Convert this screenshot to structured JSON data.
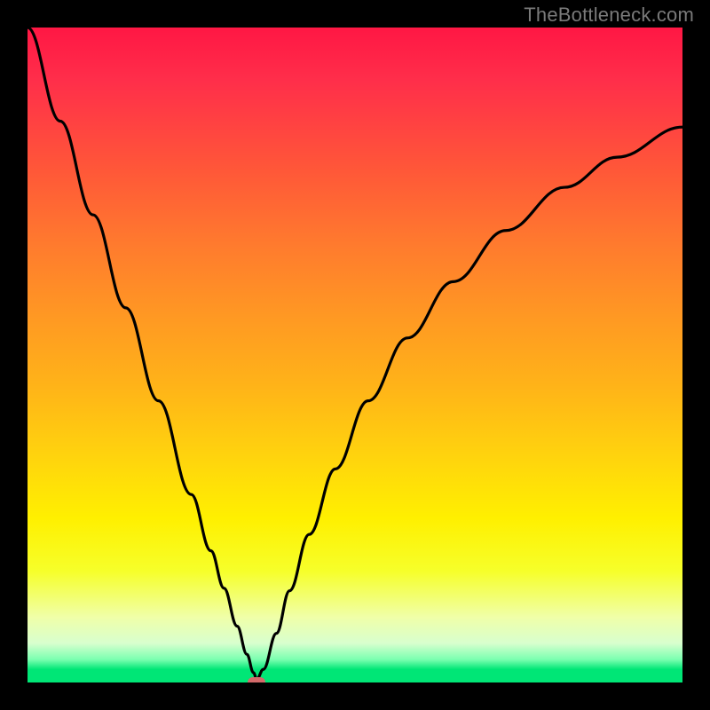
{
  "watermark": {
    "text": "TheBottleneck.com"
  },
  "chart_data": {
    "type": "line",
    "title": "",
    "xlabel": "",
    "ylabel": "",
    "xlim": [
      0,
      1
    ],
    "ylim": [
      0,
      1
    ],
    "grid": false,
    "series": [
      {
        "name": "bottleneck-curve",
        "x": [
          0.0,
          0.05,
          0.1,
          0.15,
          0.2,
          0.25,
          0.28,
          0.3,
          0.32,
          0.335,
          0.345,
          0.35,
          0.36,
          0.38,
          0.4,
          0.43,
          0.47,
          0.52,
          0.58,
          0.65,
          0.73,
          0.82,
          0.9,
          1.0
        ],
        "y": [
          1.0,
          0.857,
          0.714,
          0.572,
          0.43,
          0.287,
          0.201,
          0.144,
          0.086,
          0.043,
          0.015,
          0.005,
          0.02,
          0.075,
          0.14,
          0.226,
          0.326,
          0.43,
          0.526,
          0.612,
          0.69,
          0.756,
          0.802,
          0.848
        ]
      }
    ],
    "marker": {
      "x": 0.35,
      "y": 0.0,
      "color": "#d36a6a"
    },
    "background_gradient": {
      "top": "#ff1744",
      "bottom": "#00e676"
    }
  }
}
